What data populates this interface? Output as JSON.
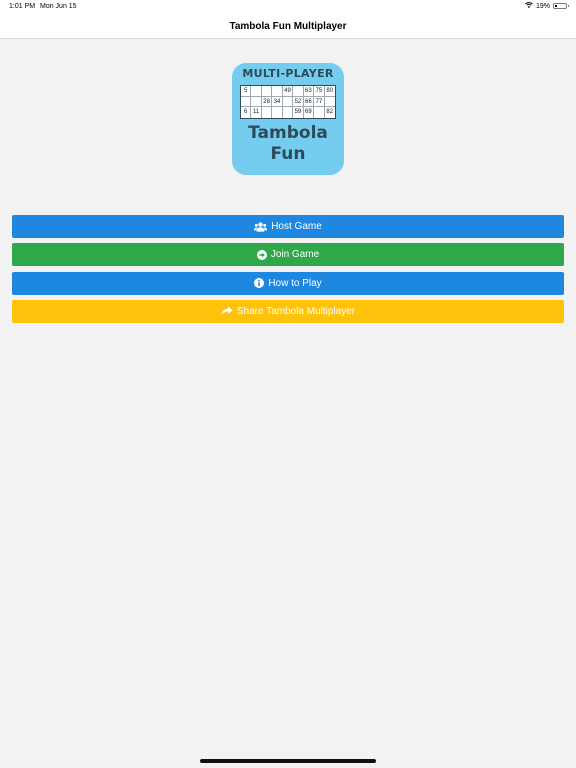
{
  "status_bar": {
    "time": "1:01 PM",
    "date": "Mon Jun 15",
    "battery": "19%",
    "battery_level": 0.19
  },
  "nav": {
    "title": "Tambola Fun Multiplayer"
  },
  "logo": {
    "top_text": "MULTI-PLAYER",
    "brand_line1": "Tambola",
    "brand_line2": "Fun",
    "ticket": [
      [
        "5",
        "",
        "",
        "",
        "49",
        "",
        "63",
        "75",
        "80"
      ],
      [
        "",
        "",
        "28",
        "34",
        "",
        "52",
        "66",
        "77",
        ""
      ],
      [
        "6",
        "11",
        "",
        "",
        "",
        "59",
        "69",
        "",
        "82"
      ]
    ]
  },
  "menu": {
    "host": {
      "label": "Host Game",
      "icon": "users-icon",
      "color": "#1e88e0"
    },
    "join": {
      "label": "Join Game",
      "icon": "arrow-circle-right-icon",
      "color": "#2ea84a"
    },
    "how": {
      "label": "How to Play",
      "icon": "info-circle-icon",
      "color": "#1e88e0"
    },
    "share": {
      "label": "Share Tambola Multiplayer",
      "icon": "share-icon",
      "color": "#ffc20a"
    }
  }
}
